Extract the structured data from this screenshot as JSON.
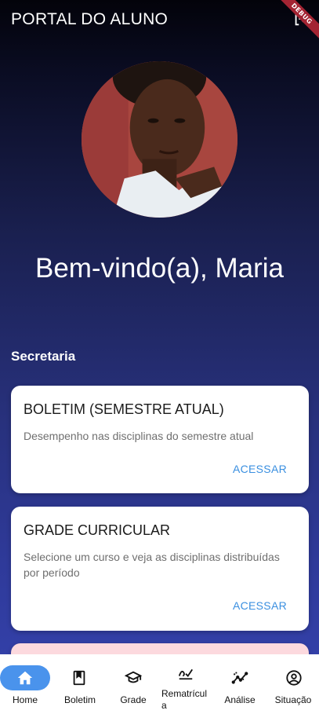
{
  "app_bar": {
    "title": "PORTAL DO ALUNO",
    "logout_icon": "logout-icon",
    "debug_banner": "DEBUG"
  },
  "profile": {
    "welcome": "Bem-vindo(a), Maria"
  },
  "section": {
    "title": "Secretaria"
  },
  "cards": [
    {
      "title": "BOLETIM (SEMESTRE ATUAL)",
      "description": "Desempenho nas disciplinas do semestre atual",
      "action": "ACESSAR"
    },
    {
      "title": "GRADE CURRICULAR",
      "description": "Selecione um curso e veja as disciplinas distribuídas por período",
      "action": "ACESSAR"
    }
  ],
  "bottom_nav": {
    "items": [
      {
        "label": "Home",
        "icon": "home-icon",
        "selected": true
      },
      {
        "label": "Boletim",
        "icon": "bookmark-icon",
        "selected": false
      },
      {
        "label": "Grade",
        "icon": "graduation-cap-icon",
        "selected": false
      },
      {
        "label": "Rematrícula",
        "icon": "signature-icon",
        "selected": false
      },
      {
        "label": "Análise",
        "icon": "analytics-icon",
        "selected": false
      },
      {
        "label": "Situação",
        "icon": "account-circle-icon",
        "selected": false
      }
    ]
  },
  "colors": {
    "accent": "#3a8fe0",
    "nav_selected": "#4a93ec",
    "debug_ribbon": "#a32433",
    "partial_card": "#fcd9de"
  }
}
